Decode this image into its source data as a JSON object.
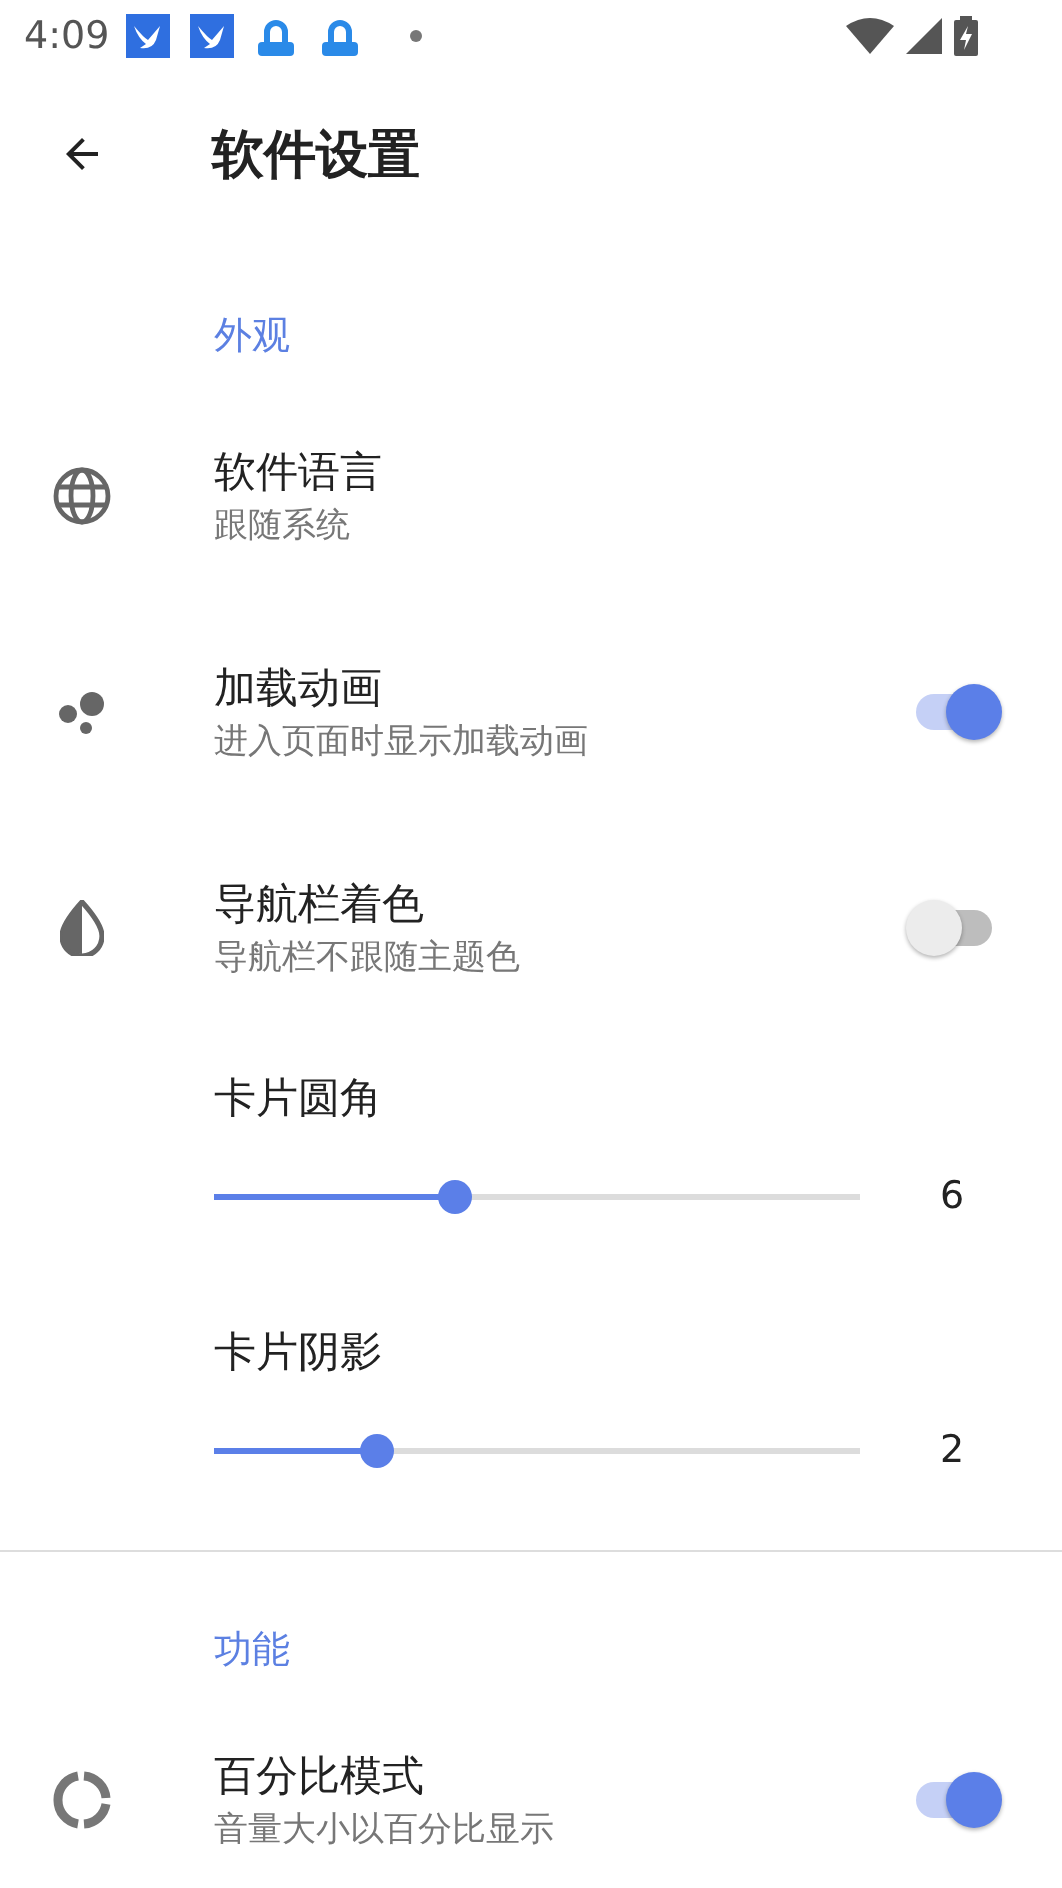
{
  "status_bar": {
    "time": "4:09"
  },
  "toolbar": {
    "title": "软件设置"
  },
  "sections": [
    {
      "header": "外观",
      "items": [
        {
          "kind": "nav",
          "title": "软件语言",
          "subtitle": "跟随系统"
        },
        {
          "kind": "switch",
          "title": "加载动画",
          "subtitle": "进入页面时显示加载动画",
          "on": true
        },
        {
          "kind": "switch",
          "title": "导航栏着色",
          "subtitle": "导航栏不跟随主题色",
          "on": false
        },
        {
          "kind": "slider",
          "title": "卡片圆角",
          "level": 0.37,
          "reading": "6"
        },
        {
          "kind": "slider",
          "title": "卡片阴影",
          "level": 0.25,
          "reading": "2"
        }
      ]
    },
    {
      "header": "功能",
      "items": [
        {
          "kind": "switch",
          "title": "百分比模式",
          "subtitle": "音量大小以百分比显示",
          "on": true
        }
      ]
    }
  ]
}
